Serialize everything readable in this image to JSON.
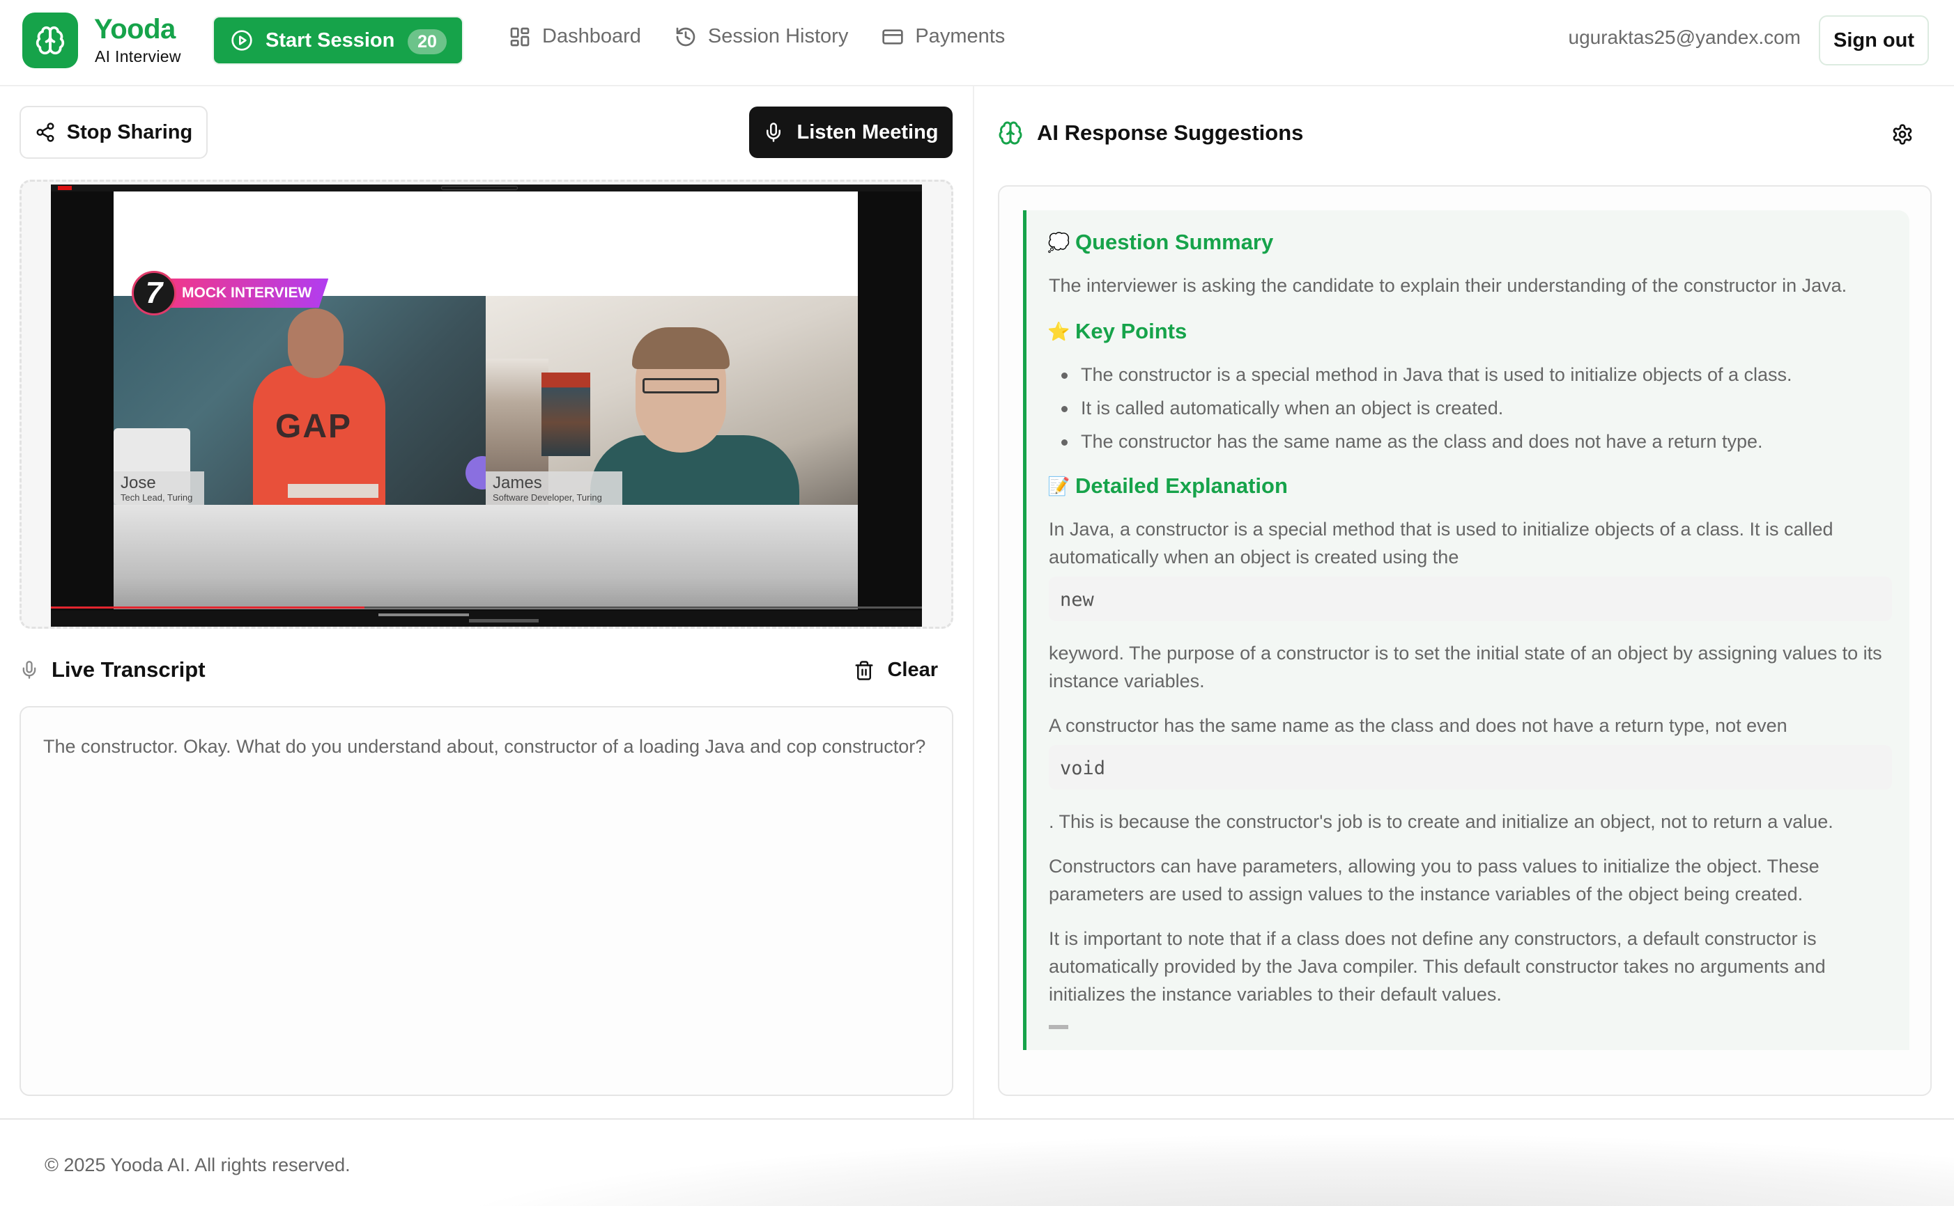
{
  "brand": {
    "name": "Yooda",
    "subtitle": "AI Interview",
    "accent_color": "#16a34a"
  },
  "header": {
    "start_session": {
      "label": "Start Session",
      "badge": "20",
      "icon": "play-circle-icon"
    },
    "nav": [
      {
        "label": "Dashboard",
        "icon": "dashboard-icon"
      },
      {
        "label": "Session History",
        "icon": "history-icon"
      },
      {
        "label": "Payments",
        "icon": "credit-card-icon"
      }
    ],
    "user_email": "uguraktas25@yandex.com",
    "sign_out_label": "Sign out"
  },
  "left_panel": {
    "stop_sharing_label": "Stop Sharing",
    "listen_meeting_label": "Listen Meeting",
    "shared_video": {
      "badge_number": "7",
      "badge_label": "MOCK INTERVIEW",
      "participants": [
        {
          "name": "Jose",
          "role": "Tech Lead, Turing"
        },
        {
          "name": "James",
          "role": "Software Developer, Turing"
        }
      ]
    },
    "transcript": {
      "title": "Live Transcript",
      "clear_label": "Clear",
      "text": "The constructor. Okay. What do you understand about, constructor of a loading Java and cop constructor?"
    }
  },
  "right_panel": {
    "title": "AI Response Suggestions",
    "sections": {
      "question_summary": {
        "emoji": "💭",
        "title": "Question Summary",
        "text": "The interviewer is asking the candidate to explain their understanding of the constructor in Java."
      },
      "key_points": {
        "emoji": "⭐",
        "title": "Key Points",
        "items": [
          "The constructor is a special method in Java that is used to initialize objects of a class.",
          "It is called automatically when an object is created.",
          "The constructor has the same name as the class and does not have a return type."
        ]
      },
      "detailed_explanation": {
        "emoji": "📝",
        "title": "Detailed Explanation",
        "p1": "In Java, a constructor is a special method that is used to initialize objects of a class. It is called automatically when an object is created using the",
        "code1": "new",
        "p2": "keyword. The purpose of a constructor is to set the initial state of an object by assigning values to its instance variables.",
        "p3": "A constructor has the same name as the class and does not have a return type, not even",
        "code2": "void",
        "p4": ". This is because the constructor's job is to create and initialize an object, not to return a value.",
        "p5": "Constructors can have parameters, allowing you to pass values to initialize the object. These parameters are used to assign values to the instance variables of the object being created.",
        "p6": "It is important to note that if a class does not define any constructors, a default constructor is automatically provided by the Java compiler. This default constructor takes no arguments and initializes the instance variables to their default values."
      }
    }
  },
  "footer": {
    "copyright": "© 2025 Yooda AI. All rights reserved."
  }
}
